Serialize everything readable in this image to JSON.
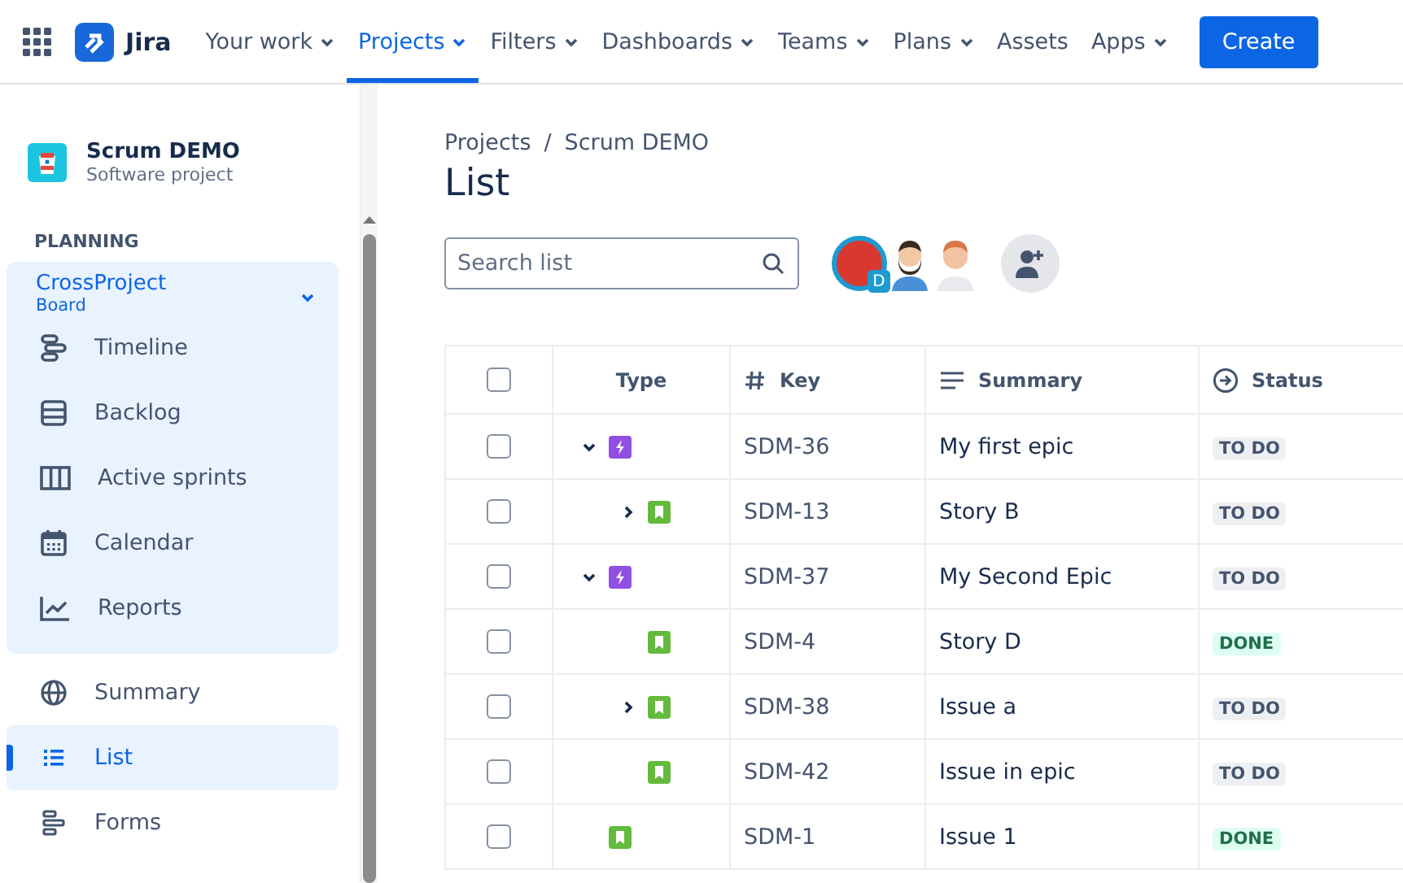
{
  "topbar": {
    "logo": "Jira",
    "nav": [
      {
        "label": "Your work",
        "dropdown": true,
        "selected": false
      },
      {
        "label": "Projects",
        "dropdown": true,
        "selected": true
      },
      {
        "label": "Filters",
        "dropdown": true,
        "selected": false
      },
      {
        "label": "Dashboards",
        "dropdown": true,
        "selected": false
      },
      {
        "label": "Teams",
        "dropdown": true,
        "selected": false
      },
      {
        "label": "Plans",
        "dropdown": true,
        "selected": false
      },
      {
        "label": "Assets",
        "dropdown": false,
        "selected": false
      },
      {
        "label": "Apps",
        "dropdown": true,
        "selected": false
      }
    ],
    "create": "Create"
  },
  "sidebar": {
    "project": {
      "name": "Scrum DEMO",
      "type": "Software project"
    },
    "section": "PLANNING",
    "board": {
      "name": "CrossProject",
      "sub": "Board",
      "expanded": true,
      "items": [
        {
          "label": "Timeline",
          "kind": "timeline"
        },
        {
          "label": "Backlog",
          "kind": "backlog"
        },
        {
          "label": "Active sprints",
          "kind": "sprints"
        },
        {
          "label": "Calendar",
          "kind": "calendar"
        },
        {
          "label": "Reports",
          "kind": "reports"
        }
      ]
    },
    "items": [
      {
        "label": "Summary",
        "kind": "summary",
        "selected": false
      },
      {
        "label": "List",
        "kind": "list",
        "selected": true
      },
      {
        "label": "Forms",
        "kind": "forms",
        "selected": false
      }
    ]
  },
  "breadcrumbs": {
    "items": [
      "Projects",
      "Scrum DEMO"
    ],
    "separator": "/"
  },
  "title": "List",
  "search": {
    "placeholder": "Search list"
  },
  "avatars": [
    {
      "badge": "D"
    }
  ],
  "table": {
    "all_checked": false,
    "columns": [
      "Type",
      "Key",
      "Summary",
      "Status"
    ],
    "rows": [
      {
        "kind": "epic",
        "key": "SDM-36",
        "summary": "My first epic",
        "status": {
          "label": "TO DO",
          "kind": "todo"
        },
        "checked": false,
        "expanded": true,
        "children": [
          {
            "kind": "story",
            "key": "SDM-13",
            "summary": "Story B",
            "status": {
              "label": "TO DO",
              "kind": "todo"
            },
            "checked": false,
            "expanded": false
          }
        ]
      },
      {
        "kind": "epic",
        "key": "SDM-37",
        "summary": "My Second Epic",
        "status": {
          "label": "TO DO",
          "kind": "todo"
        },
        "checked": false,
        "expanded": true,
        "children": [
          {
            "kind": "story",
            "key": "SDM-4",
            "summary": "Story D",
            "status": {
              "label": "DONE",
              "kind": "done"
            },
            "checked": false
          },
          {
            "kind": "story",
            "key": "SDM-38",
            "summary": "Issue a",
            "status": {
              "label": "TO DO",
              "kind": "todo"
            },
            "checked": false,
            "expanded": false
          },
          {
            "kind": "story",
            "key": "SDM-42",
            "summary": "Issue in epic",
            "status": {
              "label": "TO DO",
              "kind": "todo"
            },
            "checked": false
          }
        ]
      },
      {
        "kind": "story",
        "key": "SDM-1",
        "summary": "Issue 1",
        "status": {
          "label": "DONE",
          "kind": "done"
        },
        "checked": false
      }
    ]
  }
}
